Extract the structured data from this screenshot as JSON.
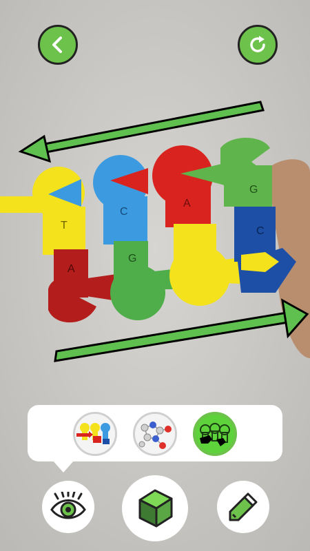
{
  "colors": {
    "accent_green": "#6cc24a",
    "adenine_red": "#d8231f",
    "thymine_yellow": "#f4e21c",
    "cytosine_blue": "#3c9be0",
    "guanine_green": "#59b44a",
    "guanine_dark_blue": "#1c4fa5",
    "panel_white": "#ffffff",
    "selected_ring": "#6cc24a"
  },
  "top_bar": {
    "back_button": {
      "icon": "chevron-left-icon"
    },
    "refresh_button": {
      "icon": "refresh-icon"
    }
  },
  "scene": {
    "description_free": true,
    "top_strand_letters": [
      "T",
      "C",
      "A",
      "G"
    ],
    "bottom_strand_letters": [
      "A",
      "G",
      "",
      "C"
    ],
    "strand_arrows": [
      "top-left",
      "bottom-right"
    ]
  },
  "mode_panel": {
    "modes": [
      {
        "id": "ladder",
        "icon": "dna-ladder-thumbnail",
        "selected": false
      },
      {
        "id": "molecule",
        "icon": "molecule-ball-thumbnail",
        "selected": false
      },
      {
        "id": "highlight",
        "icon": "highlighted-ladder-thumbnail",
        "selected": true
      }
    ]
  },
  "bottom_bar": {
    "view_button": {
      "icon": "eye-icon"
    },
    "ar_button": {
      "icon": "cube-icon"
    },
    "edit_button": {
      "icon": "pencil-icon"
    }
  }
}
